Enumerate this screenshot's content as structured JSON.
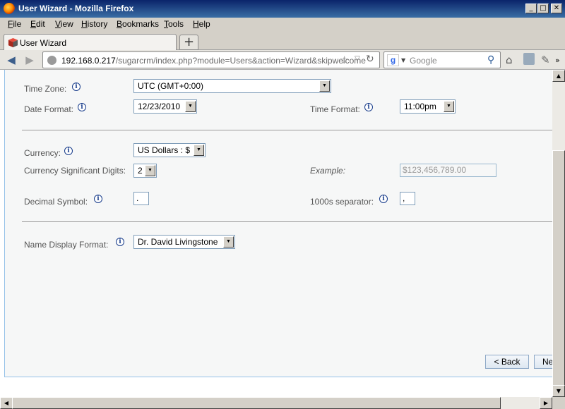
{
  "window": {
    "title": "User Wizard - Mozilla Firefox"
  },
  "menu": [
    "File",
    "Edit",
    "View",
    "History",
    "Bookmarks",
    "Tools",
    "Help"
  ],
  "tab": {
    "title": "User Wizard"
  },
  "address": {
    "host": "192.168.0.217",
    "path": "/sugarcrm/index.php?module=Users&action=Wizard&skipwelcome"
  },
  "search": {
    "placeholder": "Google"
  },
  "form": {
    "timezone": {
      "label": "Time Zone:",
      "value": "UTC (GMT+0:00)"
    },
    "date_format": {
      "label": "Date Format:",
      "value": "12/23/2010"
    },
    "time_format": {
      "label": "Time Format:",
      "value": "11:00pm"
    },
    "currency": {
      "label": "Currency:",
      "value": "US Dollars : $"
    },
    "sig_digits": {
      "label": "Currency Significant Digits:",
      "value": "2"
    },
    "example": {
      "label": "Example:",
      "value": "$123,456,789.00"
    },
    "decimal": {
      "label": "Decimal Symbol:",
      "value": "."
    },
    "thousands": {
      "label": "1000s separator:",
      "value": ","
    },
    "name_format": {
      "label": "Name Display Format:",
      "value": "Dr. David Livingstone"
    }
  },
  "buttons": {
    "back": "< Back",
    "next": "Ne"
  },
  "icons": {
    "info": "i",
    "back_arrow": "🡸",
    "forward_arrow": "🡺",
    "home": "⌂",
    "star": "☆",
    "search": "⚲"
  }
}
